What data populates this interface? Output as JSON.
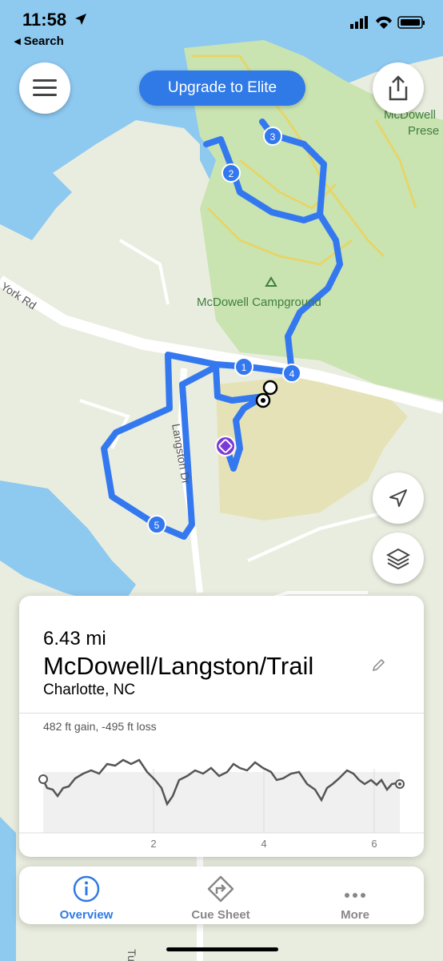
{
  "status_bar": {
    "time": "11:58",
    "back_label": "◂ Search"
  },
  "header": {
    "upgrade_label": "Upgrade to Elite"
  },
  "map": {
    "road_york": "York Rd",
    "road_langston": "Langston Dr",
    "campground": "McDowell Campground",
    "preserve_1": "McDowell",
    "preserve_2": "Prese",
    "road_bottom": "Tur",
    "waypoints": [
      "1",
      "2",
      "3",
      "4",
      "5"
    ],
    "colors": {
      "water": "#8ec9f0",
      "land": "#e9eddf",
      "forest": "#c9e3b1",
      "park": "#e6e2b8",
      "route": "#3478f0",
      "trail": "#ead45f"
    }
  },
  "route_card": {
    "distance": "6.43 mi",
    "name": "McDowell/Langston/Trail",
    "location": "Charlotte, NC",
    "elevation_summary": "482 ft gain, -495 ft loss",
    "x_ticks": [
      "2",
      "4",
      "6"
    ]
  },
  "tabs": [
    {
      "label": "Overview",
      "active": true,
      "icon": "info-icon"
    },
    {
      "label": "Cue Sheet",
      "active": false,
      "icon": "turn-icon"
    },
    {
      "label": "More",
      "active": false,
      "icon": "ellipsis-icon"
    }
  ]
}
